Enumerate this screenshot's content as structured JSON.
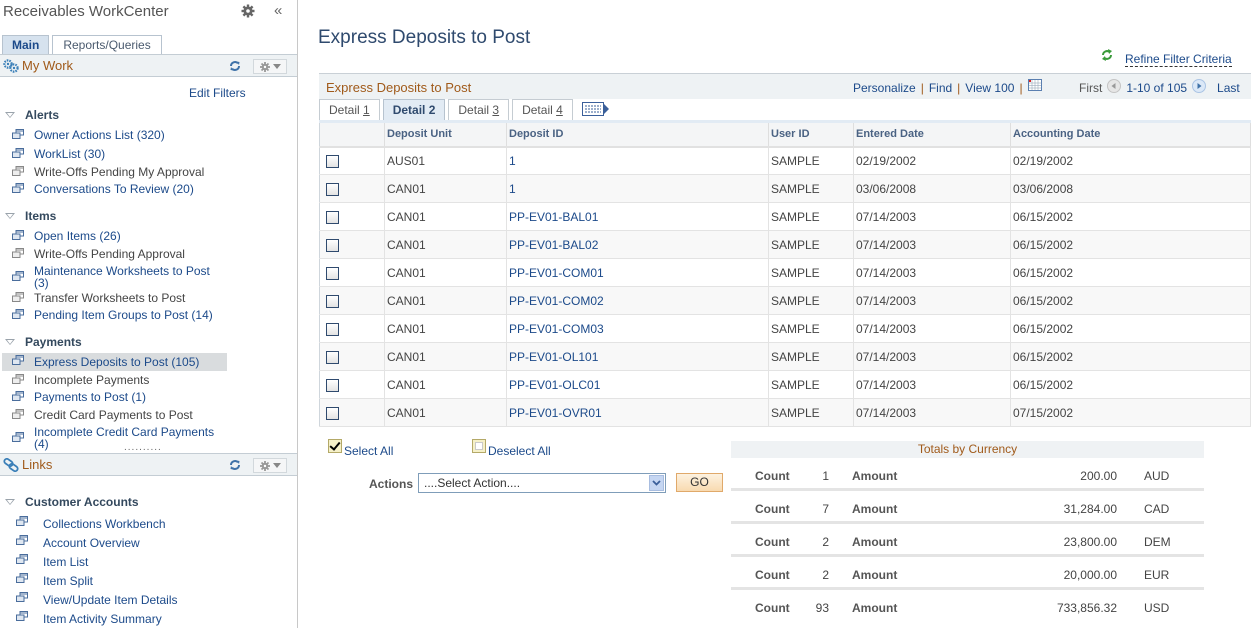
{
  "sidebar": {
    "title": "Receivables WorkCenter",
    "tabs": [
      {
        "label": "Main",
        "active": true
      },
      {
        "label": "Reports/Queries",
        "active": false
      }
    ],
    "my_work": {
      "title": "My Work",
      "edit_filters": "Edit Filters",
      "groups": [
        {
          "title": "Alerts",
          "items": [
            {
              "label": "Owner Actions List (320)",
              "link": true
            },
            {
              "label": "WorkList (30)",
              "link": true
            },
            {
              "label": "Write-Offs Pending My Approval",
              "link": false
            },
            {
              "label": "Conversations To Review (20)",
              "link": true
            }
          ]
        },
        {
          "title": "Items",
          "items": [
            {
              "label": "Open Items (26)",
              "link": true
            },
            {
              "label": "Write-Offs Pending Approval",
              "link": false
            },
            {
              "label": "Maintenance Worksheets to Post (3)",
              "link": true
            },
            {
              "label": "Transfer Worksheets to Post",
              "link": false
            },
            {
              "label": "Pending Item Groups to Post (14)",
              "link": true
            }
          ]
        },
        {
          "title": "Payments",
          "items": [
            {
              "label": "Express Deposits to Post (105)",
              "link": true,
              "selected": true
            },
            {
              "label": "Incomplete Payments",
              "link": false
            },
            {
              "label": "Payments to Post (1)",
              "link": true
            },
            {
              "label": "Credit Card Payments to Post",
              "link": false
            },
            {
              "label": "Incomplete Credit Card Payments (4)",
              "link": true
            }
          ]
        }
      ]
    },
    "links": {
      "title": "Links",
      "groups": [
        {
          "title": "Customer Accounts",
          "items": [
            {
              "label": "Collections Workbench"
            },
            {
              "label": "Account Overview"
            },
            {
              "label": "Item List"
            },
            {
              "label": "Item Split"
            },
            {
              "label": "View/Update Item Details"
            },
            {
              "label": "Item Activity Summary"
            }
          ]
        }
      ]
    }
  },
  "main": {
    "page_title": "Express Deposits to Post",
    "refine_filter": "Refine Filter Criteria",
    "grid": {
      "title": "Express Deposits to Post",
      "personalize": "Personalize",
      "find": "Find",
      "view_all": "View 100",
      "pager": {
        "first": "First",
        "range": "1-10 of 105",
        "last": "Last"
      },
      "tabs": [
        {
          "label": "Detail ",
          "key": "1",
          "active": false
        },
        {
          "label": "Detail 2",
          "key": "",
          "active": true
        },
        {
          "label": "Detail ",
          "key": "3",
          "active": false
        },
        {
          "label": "Detail ",
          "key": "4",
          "active": false
        }
      ],
      "columns": [
        "",
        "Deposit Unit",
        "Deposit ID",
        "User ID",
        "Entered Date",
        "Accounting Date"
      ],
      "rows": [
        {
          "unit": "AUS01",
          "id": "1",
          "user": "SAMPLE",
          "entered": "02/19/2002",
          "acct": "02/19/2002",
          "checked": false
        },
        {
          "unit": "CAN01",
          "id": "1",
          "user": "SAMPLE",
          "entered": "03/06/2008",
          "acct": "03/06/2008",
          "checked": false
        },
        {
          "unit": "CAN01",
          "id": "PP-EV01-BAL01",
          "user": "SAMPLE",
          "entered": "07/14/2003",
          "acct": "06/15/2002",
          "checked": false
        },
        {
          "unit": "CAN01",
          "id": "PP-EV01-BAL02",
          "user": "SAMPLE",
          "entered": "07/14/2003",
          "acct": "06/15/2002",
          "checked": false
        },
        {
          "unit": "CAN01",
          "id": "PP-EV01-COM01",
          "user": "SAMPLE",
          "entered": "07/14/2003",
          "acct": "06/15/2002",
          "checked": false
        },
        {
          "unit": "CAN01",
          "id": "PP-EV01-COM02",
          "user": "SAMPLE",
          "entered": "07/14/2003",
          "acct": "06/15/2002",
          "checked": false
        },
        {
          "unit": "CAN01",
          "id": "PP-EV01-COM03",
          "user": "SAMPLE",
          "entered": "07/14/2003",
          "acct": "06/15/2002",
          "checked": false
        },
        {
          "unit": "CAN01",
          "id": "PP-EV01-OL101",
          "user": "SAMPLE",
          "entered": "07/14/2003",
          "acct": "06/15/2002",
          "checked": false
        },
        {
          "unit": "CAN01",
          "id": "PP-EV01-OLC01",
          "user": "SAMPLE",
          "entered": "07/14/2003",
          "acct": "06/15/2002",
          "checked": false
        },
        {
          "unit": "CAN01",
          "id": "PP-EV01-OVR01",
          "user": "SAMPLE",
          "entered": "07/14/2003",
          "acct": "07/15/2002",
          "checked": false
        }
      ]
    },
    "select_all": "Select All",
    "deselect_all": "Deselect All",
    "actions": {
      "label": "Actions",
      "selected": "....Select Action....",
      "go": "GO"
    },
    "totals": {
      "title": "Totals by Currency",
      "count_label": "Count",
      "amount_label": "Amount",
      "rows": [
        {
          "count": "1",
          "amount": "200.00",
          "currency": "AUD"
        },
        {
          "count": "7",
          "amount": "31,284.00",
          "currency": "CAD"
        },
        {
          "count": "2",
          "amount": "23,800.00",
          "currency": "DEM"
        },
        {
          "count": "2",
          "amount": "20,000.00",
          "currency": "EUR"
        },
        {
          "count": "93",
          "amount": "733,856.32",
          "currency": "USD"
        }
      ]
    }
  },
  "colors": {
    "link": "#1c4a8a",
    "section_title": "#a05a1a",
    "page_title": "#2f4a6e",
    "selected_item_bg": "#d9dcde"
  }
}
